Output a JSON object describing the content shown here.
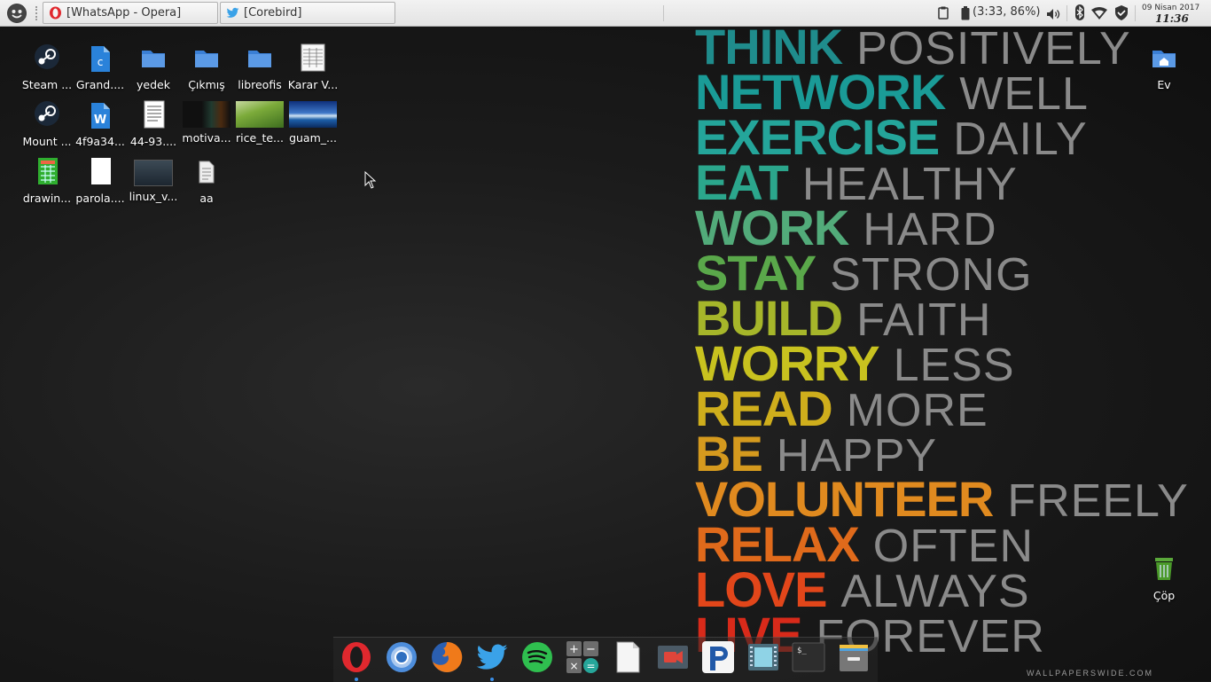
{
  "panel": {
    "tasks": [
      {
        "label": "[WhatsApp - Opera]",
        "icon": "opera-icon"
      },
      {
        "label": "[Corebird]",
        "icon": "twitter-icon"
      }
    ],
    "battery_text": "(3:33, 86%)",
    "clock": {
      "date": "09 Nisan 2017",
      "time": "11:36"
    }
  },
  "desktop": {
    "icons": [
      {
        "label": "Steam ...",
        "icon": "steam-icon"
      },
      {
        "label": "Grand....",
        "icon": "document-icon"
      },
      {
        "label": "yedek",
        "icon": "folder-icon"
      },
      {
        "label": "Çıkmış",
        "icon": "folder-icon"
      },
      {
        "label": "libreofis",
        "icon": "folder-icon"
      },
      {
        "label": "Karar V...",
        "icon": "spreadsheet-icon"
      },
      {
        "label": "Mount ...",
        "icon": "steam-icon"
      },
      {
        "label": "4f9a34...",
        "icon": "word-icon"
      },
      {
        "label": "44-93....",
        "icon": "text-document-icon"
      },
      {
        "label": "motiva...",
        "icon": "image-thumbnail"
      },
      {
        "label": "rice_te...",
        "icon": "image-thumbnail"
      },
      {
        "label": "guam_...",
        "icon": "image-thumbnail"
      },
      {
        "label": "drawin...",
        "icon": "drawing-icon"
      },
      {
        "label": "parola....",
        "icon": "blank-document-icon"
      },
      {
        "label": "linux_v...",
        "icon": "video-thumbnail"
      },
      {
        "label": "aa",
        "icon": "text-file-icon"
      }
    ],
    "home": {
      "label": "Ev",
      "icon": "home-folder-icon"
    },
    "trash": {
      "label": "Çöp",
      "icon": "trash-icon"
    }
  },
  "wallpaper": {
    "lines": [
      {
        "bold": "THINK",
        "thin": "POSITIVELY",
        "color": "#1f8c8c"
      },
      {
        "bold": "NETWORK",
        "thin": "WELL",
        "color": "#1a9b97"
      },
      {
        "bold": "EXERCISE",
        "thin": "DAILY",
        "color": "#24a59a"
      },
      {
        "bold": "EAT",
        "thin": "HEALTHY",
        "color": "#2ba68c"
      },
      {
        "bold": "WORK",
        "thin": "HARD",
        "color": "#52ab7a"
      },
      {
        "bold": "STAY",
        "thin": "STRONG",
        "color": "#5aa84a"
      },
      {
        "bold": "BUILD",
        "thin": "FAITH",
        "color": "#a6b62a"
      },
      {
        "bold": "WORRY",
        "thin": "LESS",
        "color": "#c8c21f"
      },
      {
        "bold": "READ",
        "thin": "MORE",
        "color": "#cfae1c"
      },
      {
        "bold": "BE",
        "thin": "HAPPY",
        "color": "#d59a1e"
      },
      {
        "bold": "VOLUNTEER",
        "thin": "FREELY",
        "color": "#e08a1f"
      },
      {
        "bold": "RELAX",
        "thin": "OFTEN",
        "color": "#e06a1b"
      },
      {
        "bold": "LOVE",
        "thin": "ALWAYS",
        "color": "#e2461a"
      },
      {
        "bold": "LIVE",
        "thin": "FOREVER",
        "color": "#d82a1a"
      }
    ],
    "watermark": "WALLPAPERSWIDE.COM"
  },
  "dock": {
    "apps": [
      "opera-icon",
      "chromium-icon",
      "firefox-icon",
      "twitter-icon",
      "spotify-icon",
      "calculator-icon",
      "text-editor-icon",
      "screen-recorder-icon",
      "pandora-icon",
      "video-player-icon",
      "terminal-icon",
      "archive-manager-icon"
    ]
  }
}
